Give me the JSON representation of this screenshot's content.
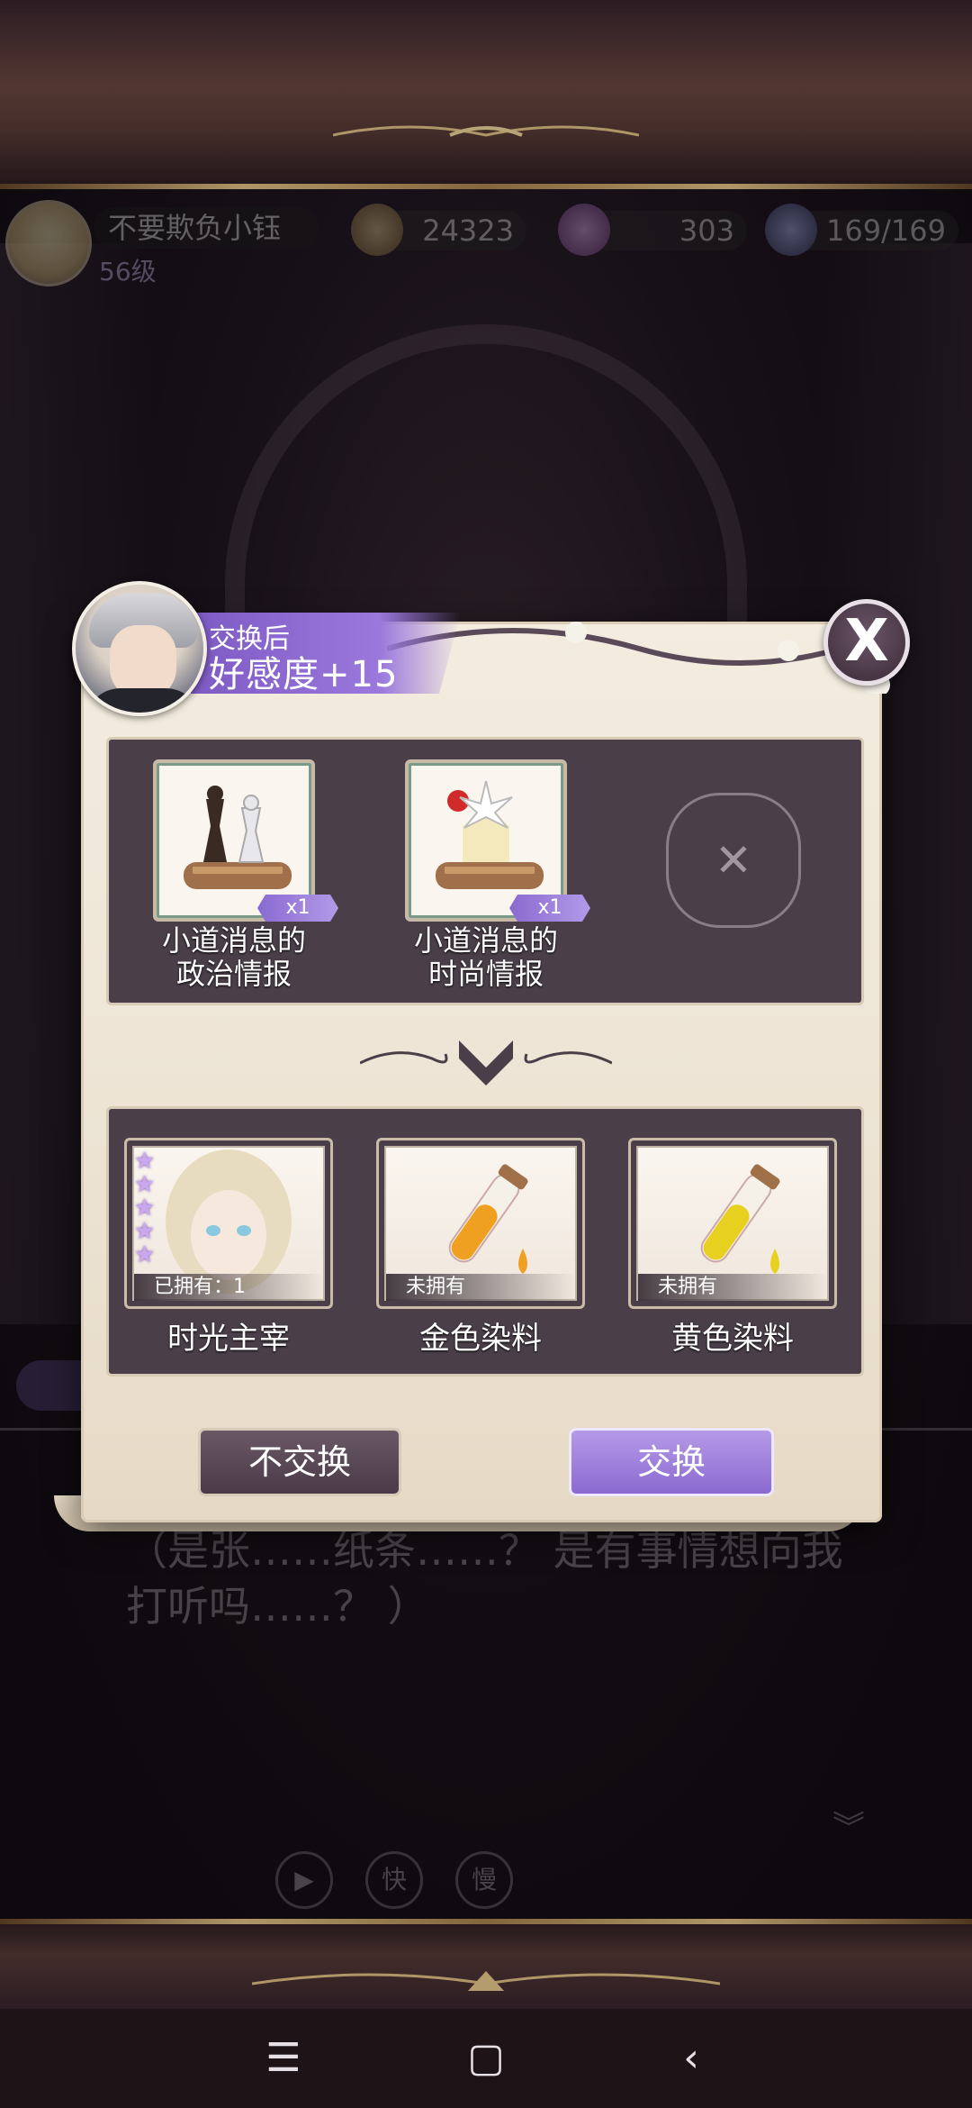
{
  "status": {
    "player_name": "不要欺负小钰",
    "level": "56级",
    "gold": "24323",
    "gems": "303",
    "energy": "169/169"
  },
  "dialog": {
    "line": "（是张……纸条……？ 是有事情想向我打听吗……？ ）"
  },
  "controls": {
    "play_icon": "play-icon",
    "fast": "快",
    "slow": "慢"
  },
  "modal": {
    "banner_sub": "交换后",
    "banner_main": "好感度+15",
    "close_label": "X",
    "give_items": [
      {
        "label_line1": "小道消息的",
        "label_line2": "政治情报",
        "qty": "x1",
        "icon": "chess-scroll-icon"
      },
      {
        "label_line1": "小道消息的",
        "label_line2": "时尚情报",
        "qty": "x1",
        "icon": "flower-scroll-icon"
      }
    ],
    "empty_slot_icon": "empty-slot-icon",
    "get_items": [
      {
        "label": "时光主宰",
        "owned": "已拥有：1",
        "stars": 5,
        "icon": "character-card-icon"
      },
      {
        "label": "金色染料",
        "owned": "未拥有",
        "icon": "gold-dye-vial-icon",
        "color": "#f0a020"
      },
      {
        "label": "黄色染料",
        "owned": "未拥有",
        "icon": "yellow-dye-vial-icon",
        "color": "#e8d020"
      }
    ],
    "decline_label": "不交换",
    "confirm_label": "交换"
  },
  "colors": {
    "accent_purple": "#9a78dc",
    "panel_dark": "#4a3e48",
    "parchment": "#f3ecdf"
  }
}
